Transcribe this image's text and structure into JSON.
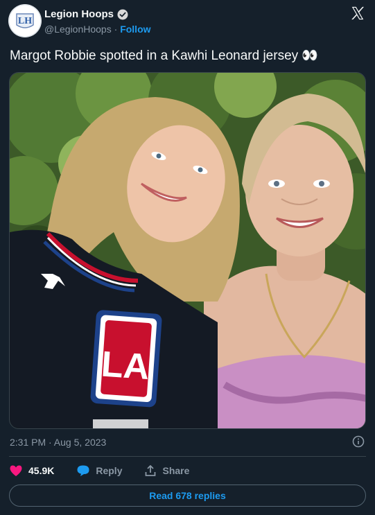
{
  "account": {
    "display_name": "Legion Hoops",
    "handle": "@LegionHoops",
    "separator": "·",
    "follow_label": "Follow",
    "logo_text": "LH"
  },
  "tweet": {
    "text": "Margot Robbie spotted in a Kawhi Leonard jersey 👀",
    "timestamp": "2:31 PM · Aug 5, 2023"
  },
  "image": {
    "jersey_logo_text": "LA",
    "jersey_brand_icon": "jumpman-icon"
  },
  "actions": {
    "likes": "45.9K",
    "reply_label": "Reply",
    "share_label": "Share"
  },
  "footer": {
    "read_replies_label": "Read 678 replies"
  },
  "colors": {
    "background": "#15202b",
    "accent": "#1d9bf0",
    "like": "#f91880",
    "muted_text": "#8b98a5",
    "border": "#38444d"
  }
}
